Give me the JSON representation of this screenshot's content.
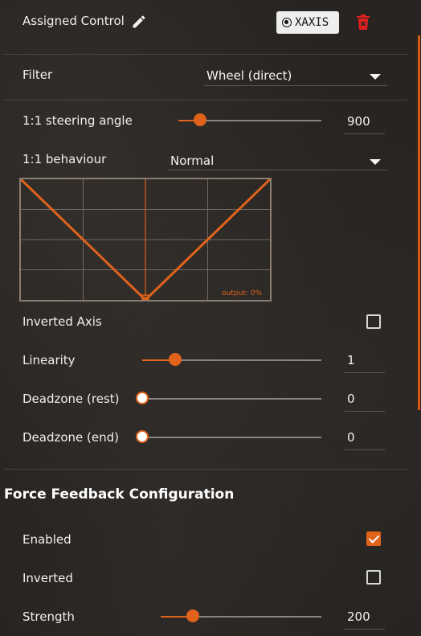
{
  "header": {
    "title": "Assigned Control",
    "edit_icon": "pencil-icon",
    "axis_badge": "XAXIS",
    "axis_icon": "radio-target-icon",
    "delete_icon": "trash-icon",
    "delete_color": "#e02020"
  },
  "filter": {
    "label": "Filter",
    "value": "Wheel (direct)"
  },
  "steering": {
    "label": "1:1 steering angle",
    "value": "900",
    "level": 0.15
  },
  "behaviour": {
    "label": "1:1 behaviour",
    "value": "Normal"
  },
  "graph": {
    "output_text": "output: 0%",
    "curve": [
      [
        -1,
        1
      ],
      [
        0,
        0
      ],
      [
        1,
        1
      ]
    ],
    "marker": [
      0,
      0
    ]
  },
  "inverted_axis": {
    "label": "Inverted Axis",
    "checked": false
  },
  "linearity": {
    "label": "Linearity",
    "value": "1",
    "level": 0.18
  },
  "deadzone_rest": {
    "label": "Deadzone (rest)",
    "value": "0",
    "level": 0
  },
  "deadzone_end": {
    "label": "Deadzone (end)",
    "value": "0",
    "level": 0
  },
  "ffb": {
    "title": "Force Feedback Configuration",
    "enabled": {
      "label": "Enabled",
      "checked": true
    },
    "inverted": {
      "label": "Inverted",
      "checked": false
    },
    "strength": {
      "label": "Strength",
      "value": "200",
      "level": 0.2
    }
  },
  "colors": {
    "accent": "#e0621b",
    "background": "#272421",
    "text": "#f0f0f0"
  }
}
